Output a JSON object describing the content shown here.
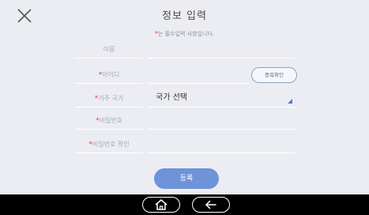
{
  "header": {
    "title": "정보 입력",
    "required_mark": "*",
    "notice": "는 필수입력 사항입니다."
  },
  "form": {
    "fields": [
      {
        "label": "이름",
        "required": false,
        "value": ""
      },
      {
        "label": "아이디",
        "required": true,
        "value": "",
        "button": "중복확인"
      },
      {
        "label": "거주 국가",
        "required": true,
        "value": "국가 선택"
      },
      {
        "label": "비밀번호",
        "required": true,
        "value": ""
      },
      {
        "label": "비밀번호 확인",
        "required": true,
        "value": ""
      }
    ],
    "required_mark": "*",
    "submit_label": "등록"
  },
  "nav": {
    "buttons": [
      "home-icon",
      "back-icon"
    ]
  },
  "colors": {
    "background": "#ecedf2",
    "accent": "#6e93d8",
    "required": "#e53935",
    "nav_bar": "#000000"
  }
}
